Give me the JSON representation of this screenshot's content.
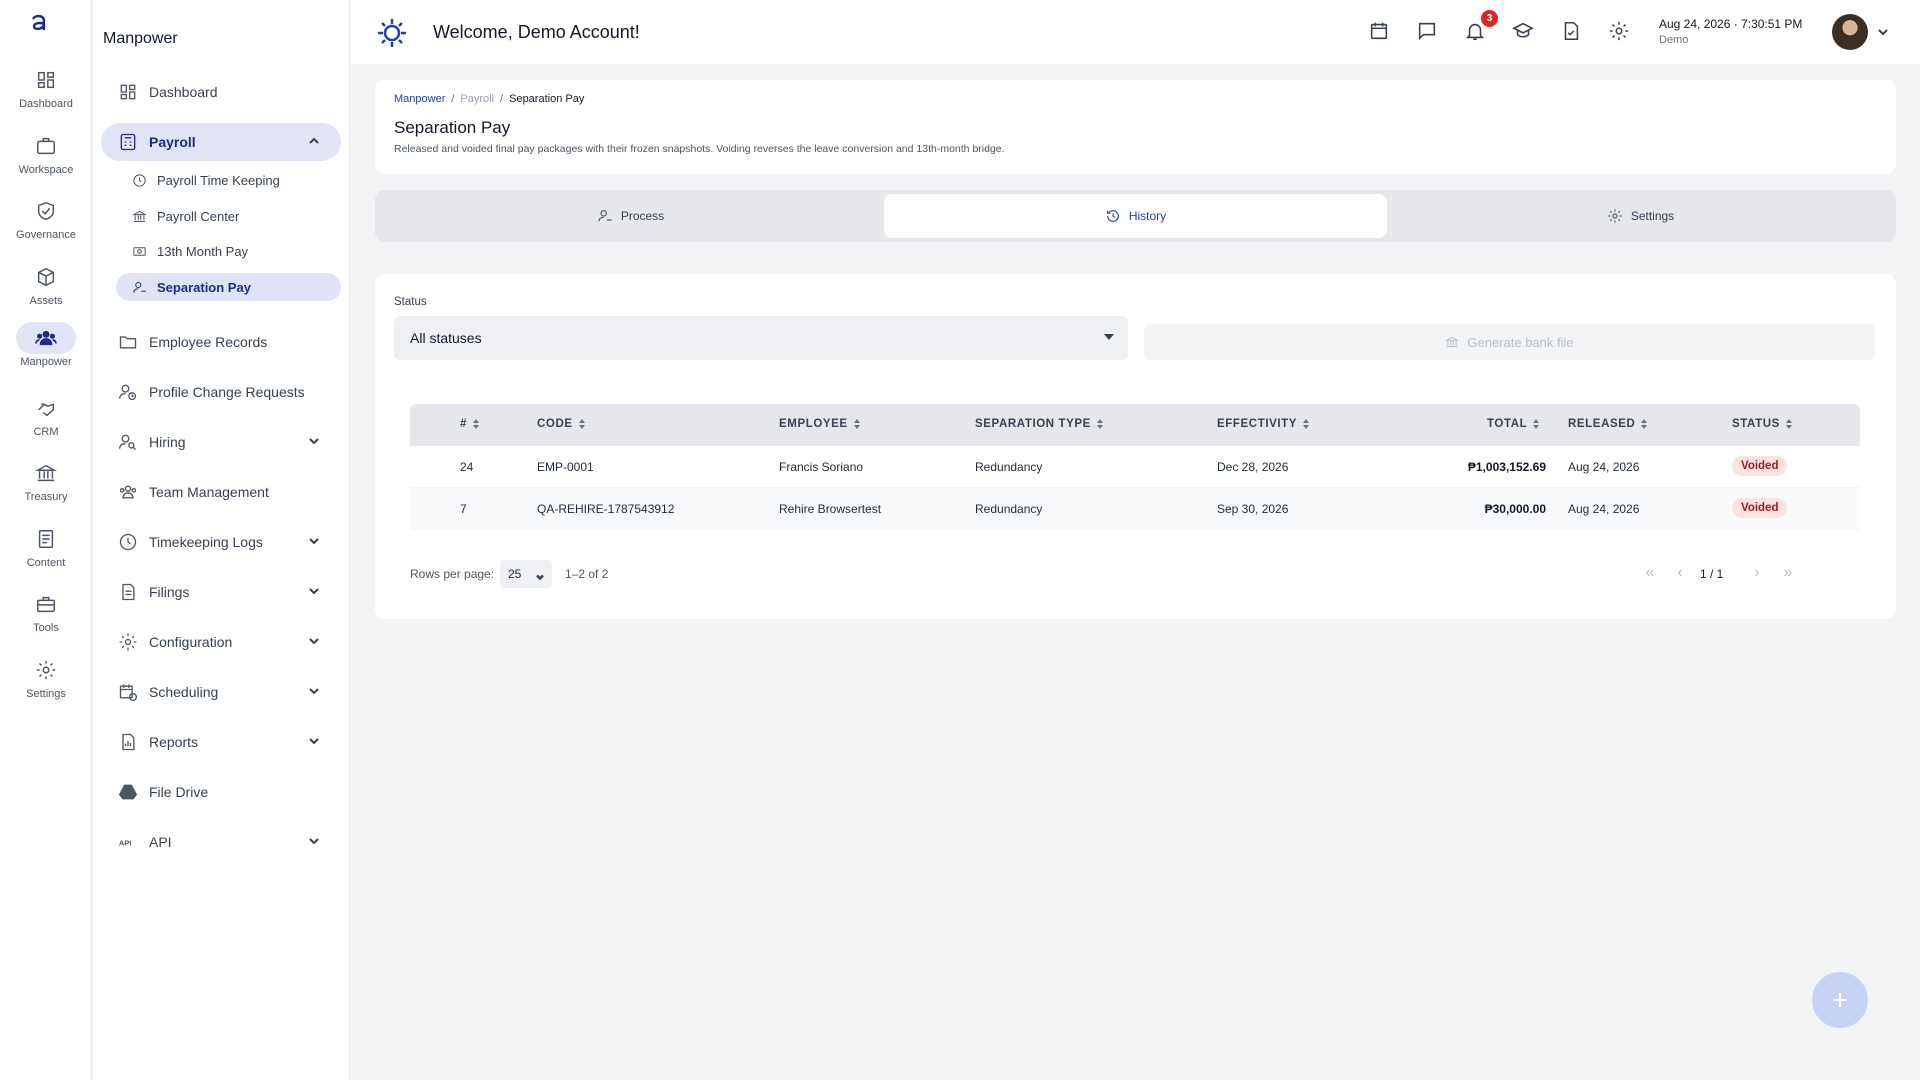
{
  "rail": {
    "items": [
      {
        "label": "Dashboard",
        "icon": "grid-icon"
      },
      {
        "label": "Workspace",
        "icon": "briefcase-icon"
      },
      {
        "label": "Governance",
        "icon": "shield-icon"
      },
      {
        "label": "Assets",
        "icon": "cube-icon"
      },
      {
        "label": "Manpower",
        "icon": "people-icon"
      },
      {
        "label": "CRM",
        "icon": "handshake-icon"
      },
      {
        "label": "Treasury",
        "icon": "bank-icon"
      },
      {
        "label": "Content",
        "icon": "document-icon"
      },
      {
        "label": "Tools",
        "icon": "toolbox-icon"
      },
      {
        "label": "Settings",
        "icon": "gear-icon"
      }
    ]
  },
  "sidebar": {
    "title": "Manpower",
    "items": [
      {
        "label": "Dashboard"
      },
      {
        "label": "Payroll"
      },
      {
        "label": "Employee Records"
      },
      {
        "label": "Profile Change Requests"
      },
      {
        "label": "Hiring"
      },
      {
        "label": "Team Management"
      },
      {
        "label": "Timekeeping Logs"
      },
      {
        "label": "Filings"
      },
      {
        "label": "Configuration"
      },
      {
        "label": "Scheduling"
      },
      {
        "label": "Reports"
      },
      {
        "label": "File Drive"
      },
      {
        "label": "API"
      }
    ],
    "payroll_sub": [
      {
        "label": "Payroll Time Keeping"
      },
      {
        "label": "Payroll Center"
      },
      {
        "label": "13th Month Pay"
      },
      {
        "label": "Separation Pay"
      }
    ]
  },
  "header": {
    "welcome": "Welcome, Demo Account!",
    "notification_count": "3",
    "datetime": "Aug 24, 2026 · 7:30:51 PM",
    "user": "Demo"
  },
  "breadcrumb": {
    "items": [
      "Manpower",
      "Payroll",
      "Separation Pay"
    ],
    "sep": "/"
  },
  "page": {
    "title": "Separation Pay",
    "subtitle": "Released and voided final pay packages with their frozen snapshots. Voiding reverses the leave conversion and 13th-month bridge."
  },
  "tabs": [
    {
      "label": "Process"
    },
    {
      "label": "History"
    },
    {
      "label": "Settings"
    }
  ],
  "filters": {
    "status_label": "Status",
    "status_value": "All statuses",
    "generate_label": "Generate bank file"
  },
  "table": {
    "columns": [
      "#",
      "CODE",
      "EMPLOYEE",
      "SEPARATION TYPE",
      "EFFECTIVITY",
      "TOTAL",
      "RELEASED",
      "STATUS"
    ],
    "rows": [
      {
        "num": "24",
        "code": "EMP-0001",
        "employee": "Francis Soriano",
        "type": "Redundancy",
        "effectivity": "Dec 28, 2026",
        "total": "₱1,003,152.69",
        "released": "Aug 24, 2026",
        "status": "Voided"
      },
      {
        "num": "7",
        "code": "QA-REHIRE-1787543912",
        "employee": "Rehire Browsertest",
        "type": "Redundancy",
        "effectivity": "Sep 30, 2026",
        "total": "₱30,000.00",
        "released": "Aug 24, 2026",
        "status": "Voided"
      }
    ]
  },
  "pagination": {
    "rows_per_page_label": "Rows per page:",
    "rows_per_page": "25",
    "range": "1–2 of 2",
    "page": "1 / 1"
  },
  "colors": {
    "accent": "#1e2a8a",
    "voided_bg": "#fde2e2",
    "voided_text": "#991b1b"
  }
}
